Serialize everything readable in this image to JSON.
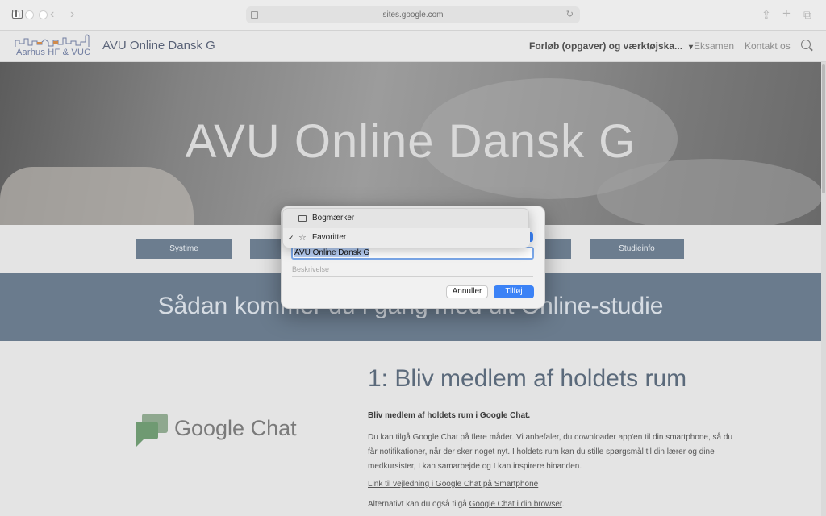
{
  "browser": {
    "url": "sites.google.com"
  },
  "site": {
    "logo_text": "Aarhus HF & VUC",
    "title": "AVU Online Dansk G",
    "nav": {
      "main": "Forløb (opgaver) og værktøjska...",
      "items": [
        "Eksamen",
        "Kontakt os"
      ]
    }
  },
  "hero": {
    "title": "AVU Online Dansk G"
  },
  "buttons": {
    "systime": "Systime",
    "studieinfo": "Studieinfo"
  },
  "band": {
    "title": "Sådan kommer du i gang med dit Online-studie"
  },
  "content": {
    "gchat_label": "Google Chat",
    "heading": "1: Bliv medlem af holdets rum",
    "lead": "Bliv medlem af holdets rum i Google Chat.",
    "paragraph": "Du kan tilgå Google Chat på flere måder. Vi anbefaler, du downloader app'en til din smartphone, så du får notifikationer, når der sker noget nyt. I holdets rum kan du stille spørgsmål til din lærer og dine medkursister, I kan samarbejde og I kan inspirere hinanden.",
    "link": "Link til vejledning i Google Chat på Smartphone",
    "alt_prefix": "Alternativt kan du også tilgå ",
    "alt_link": "Google Chat i din browser",
    "alt_suffix": "."
  },
  "bookmark_dialog": {
    "options": [
      "Bogmærker",
      "Favoritter"
    ],
    "selected": "Favoritter",
    "title_value": "AVU Online Dansk G",
    "description_placeholder": "Beskrivelse",
    "cancel_label": "Annuller",
    "add_label": "Tilføj"
  },
  "colors": {
    "accent": "#3b82f6",
    "band": "#6a7b8d",
    "button": "#6c7d8f"
  }
}
